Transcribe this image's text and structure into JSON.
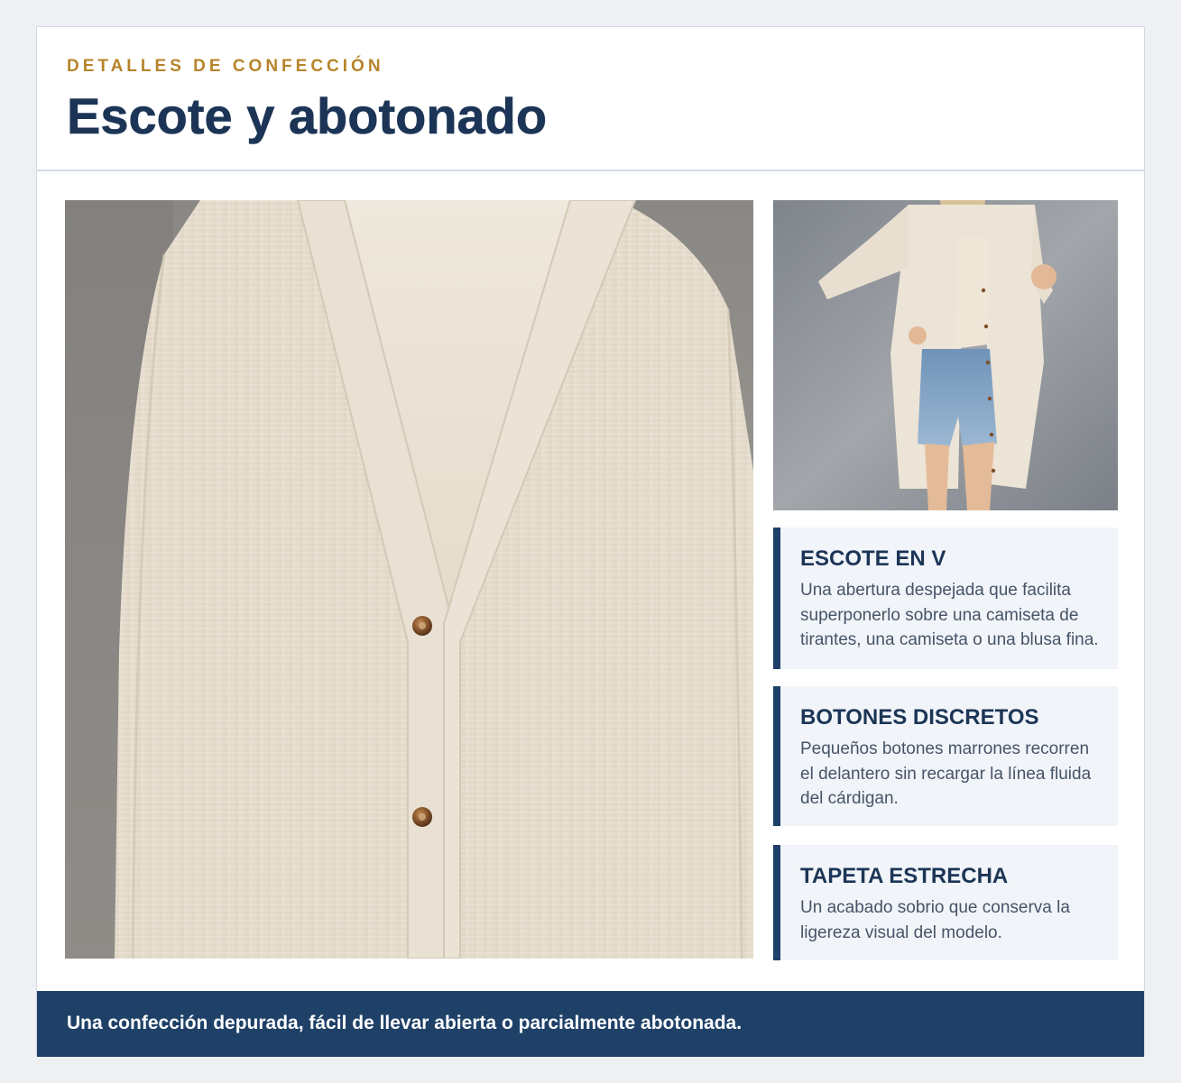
{
  "header": {
    "eyebrow": "DETALLES DE CONFECCIÓN",
    "title": "Escote y abotonado"
  },
  "images": {
    "main": "cardigan-neckline-closeup-photo",
    "side": "model-wearing-cardigan-photo"
  },
  "features": [
    {
      "title": "ESCOTE EN V",
      "text": "Una abertura despejada que facilita superponerlo sobre una camiseta de tirantes, una camiseta o una blusa fina."
    },
    {
      "title": "BOTONES DISCRETOS",
      "text": "Pequeños botones marrones recorren el delantero sin recargar la línea fluida del cárdigan."
    },
    {
      "title": "TAPETA ESTRECHA",
      "text": "Un acabado sobrio que conserva la ligereza visual del modelo."
    }
  ],
  "footer": {
    "text": "Una confección depurada, fácil de llevar abierta o parcialmente abotonada."
  },
  "colors": {
    "accent": "#b7842a",
    "navy": "#1f4168",
    "title": "#1c3556",
    "feature_bg": "#f1f4f9",
    "page_bg": "#eef0f4"
  }
}
